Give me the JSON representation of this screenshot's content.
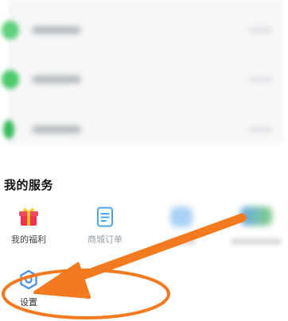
{
  "services": {
    "title": "我的服务",
    "items": [
      {
        "label": "我的福利",
        "icon": "gift-icon"
      },
      {
        "label": "商城订单",
        "icon": "order-document-icon"
      }
    ],
    "settings": {
      "label": "设置",
      "icon": "gear-hexagon-icon"
    }
  },
  "colors": {
    "gift_red": "#f0344f",
    "gift_yellow": "#ffc81e",
    "order_blue": "#4ba3ea",
    "settings_blue": "#4a8fe2",
    "annotation_orange": "#f37a1f",
    "blurred_green": "#4cc96a"
  }
}
